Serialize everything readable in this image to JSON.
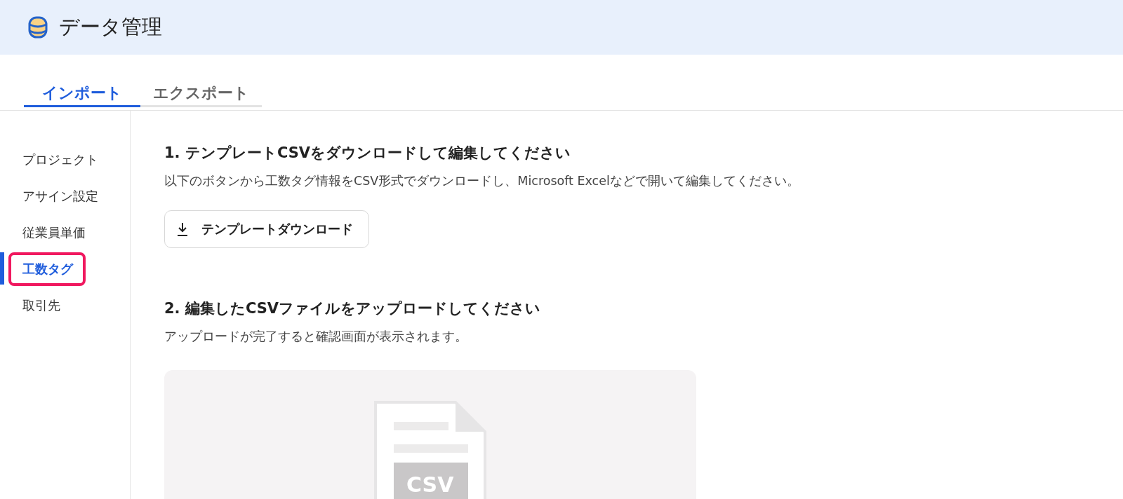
{
  "header": {
    "title": "データ管理"
  },
  "tabs": [
    {
      "label": "インポート",
      "selected": true
    },
    {
      "label": "エクスポート",
      "selected": false
    }
  ],
  "sidebar": {
    "items": [
      {
        "label": "プロジェクト",
        "selected": false,
        "highlighted": false
      },
      {
        "label": "アサイン設定",
        "selected": false,
        "highlighted": false
      },
      {
        "label": "従業員単価",
        "selected": false,
        "highlighted": false
      },
      {
        "label": "工数タグ",
        "selected": true,
        "highlighted": true
      },
      {
        "label": "取引先",
        "selected": false,
        "highlighted": false
      }
    ]
  },
  "steps": [
    {
      "heading": "1. テンプレートCSVをダウンロードして編集してください",
      "description": "以下のボタンから工数タグ情報をCSV形式でダウンロードし、Microsoft Excelなどで開いて編集してください。",
      "kind": "download",
      "button": "テンプレートダウンロード"
    },
    {
      "heading": "2. 編集したCSVファイルをアップロードしてください",
      "description": "アップロードが完了すると確認画面が表示されます。",
      "kind": "upload",
      "file_label": "CSV"
    }
  ]
}
